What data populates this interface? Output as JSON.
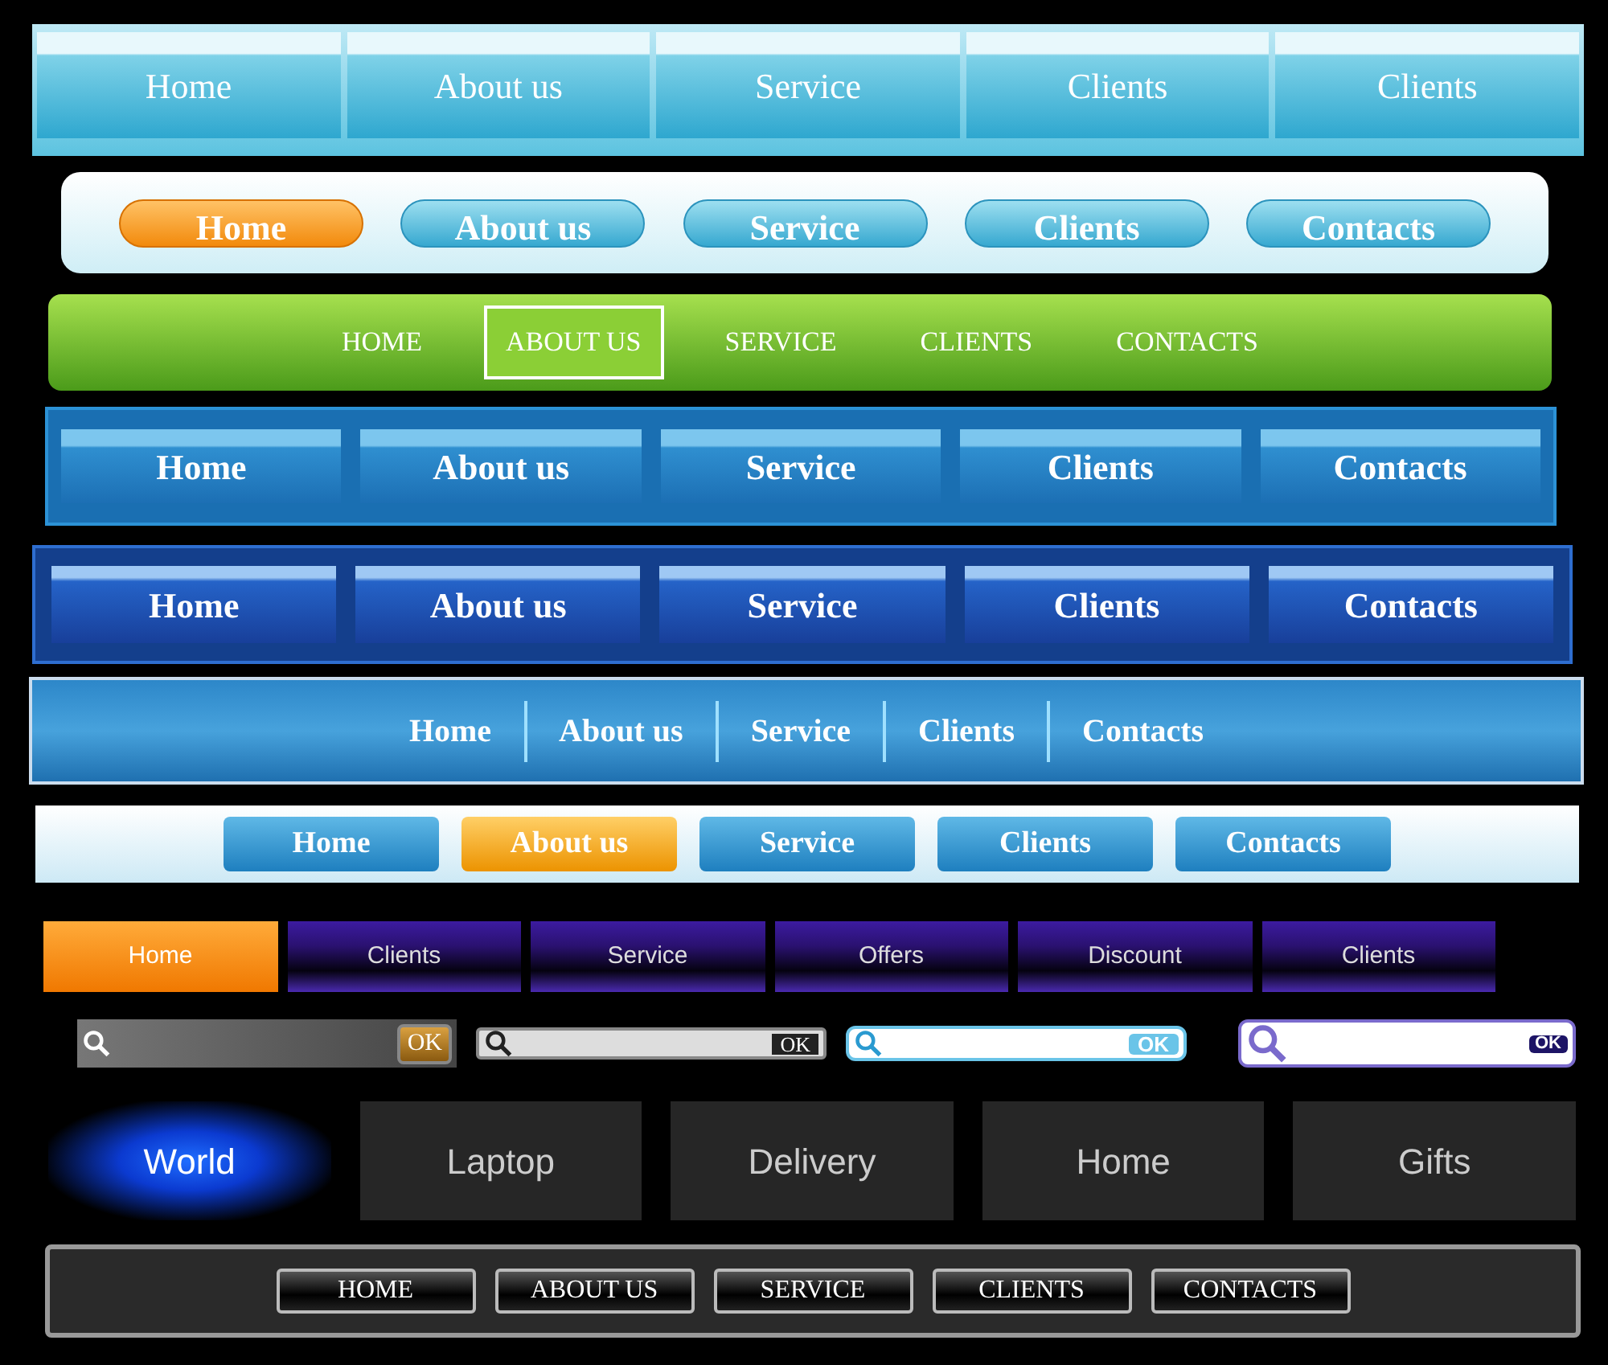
{
  "bars": [
    {
      "kind": "glass",
      "items": [
        {
          "label": "Home"
        },
        {
          "label": "About us"
        },
        {
          "label": "Service"
        },
        {
          "label": "Clients"
        },
        {
          "label": "Clients"
        }
      ]
    },
    {
      "kind": "pill",
      "items": [
        {
          "label": "Home",
          "selected": true
        },
        {
          "label": "About us",
          "selected": false
        },
        {
          "label": "Service",
          "selected": false
        },
        {
          "label": "Clients",
          "selected": false
        },
        {
          "label": "Contacts",
          "selected": false
        }
      ]
    },
    {
      "kind": "green",
      "items": [
        {
          "label": "HOME",
          "selected": false
        },
        {
          "label": "ABOUT US",
          "selected": true
        },
        {
          "label": "SERVICE",
          "selected": false
        },
        {
          "label": "CLIENTS",
          "selected": false
        },
        {
          "label": "CONTACTS",
          "selected": false
        }
      ]
    },
    {
      "kind": "blue",
      "items": [
        {
          "label": "Home"
        },
        {
          "label": "About us"
        },
        {
          "label": "Service"
        },
        {
          "label": "Clients"
        },
        {
          "label": "Contacts"
        }
      ]
    },
    {
      "kind": "navy",
      "items": [
        {
          "label": "Home"
        },
        {
          "label": "About us"
        },
        {
          "label": "Service"
        },
        {
          "label": "Clients"
        },
        {
          "label": "Contacts"
        }
      ]
    },
    {
      "kind": "divided",
      "items": [
        {
          "label": "Home"
        },
        {
          "label": "About us"
        },
        {
          "label": "Service"
        },
        {
          "label": "Clients"
        },
        {
          "label": "Contacts"
        }
      ]
    },
    {
      "kind": "light",
      "items": [
        {
          "label": "Home",
          "selected": false
        },
        {
          "label": "About us",
          "selected": true
        },
        {
          "label": "Service",
          "selected": false
        },
        {
          "label": "Clients",
          "selected": false
        },
        {
          "label": "Contacts",
          "selected": false
        }
      ]
    },
    {
      "kind": "dark",
      "items": [
        {
          "label": "Home",
          "selected": true
        },
        {
          "label": "Clients",
          "selected": false
        },
        {
          "label": "Service",
          "selected": false
        },
        {
          "label": "Offers",
          "selected": false
        },
        {
          "label": "Discount",
          "selected": false
        },
        {
          "label": "Clients",
          "selected": false
        }
      ]
    },
    {
      "kind": "searches",
      "fields": [
        {
          "kind": "dark",
          "button": "OK"
        },
        {
          "kind": "grey",
          "button": "OK"
        },
        {
          "kind": "light",
          "button": "OK"
        },
        {
          "kind": "lens",
          "button": "OK"
        }
      ]
    },
    {
      "kind": "tiles",
      "items": [
        {
          "label": "World",
          "selected": true
        },
        {
          "label": "Laptop",
          "selected": false
        },
        {
          "label": "Delivery",
          "selected": false
        },
        {
          "label": "Home",
          "selected": false
        },
        {
          "label": "Gifts",
          "selected": false
        }
      ]
    },
    {
      "kind": "metal",
      "items": [
        {
          "label": "HOME"
        },
        {
          "label": "ABOUT US"
        },
        {
          "label": "SERVICE"
        },
        {
          "label": "CLIENTS"
        },
        {
          "label": "CONTACTS"
        }
      ]
    }
  ]
}
